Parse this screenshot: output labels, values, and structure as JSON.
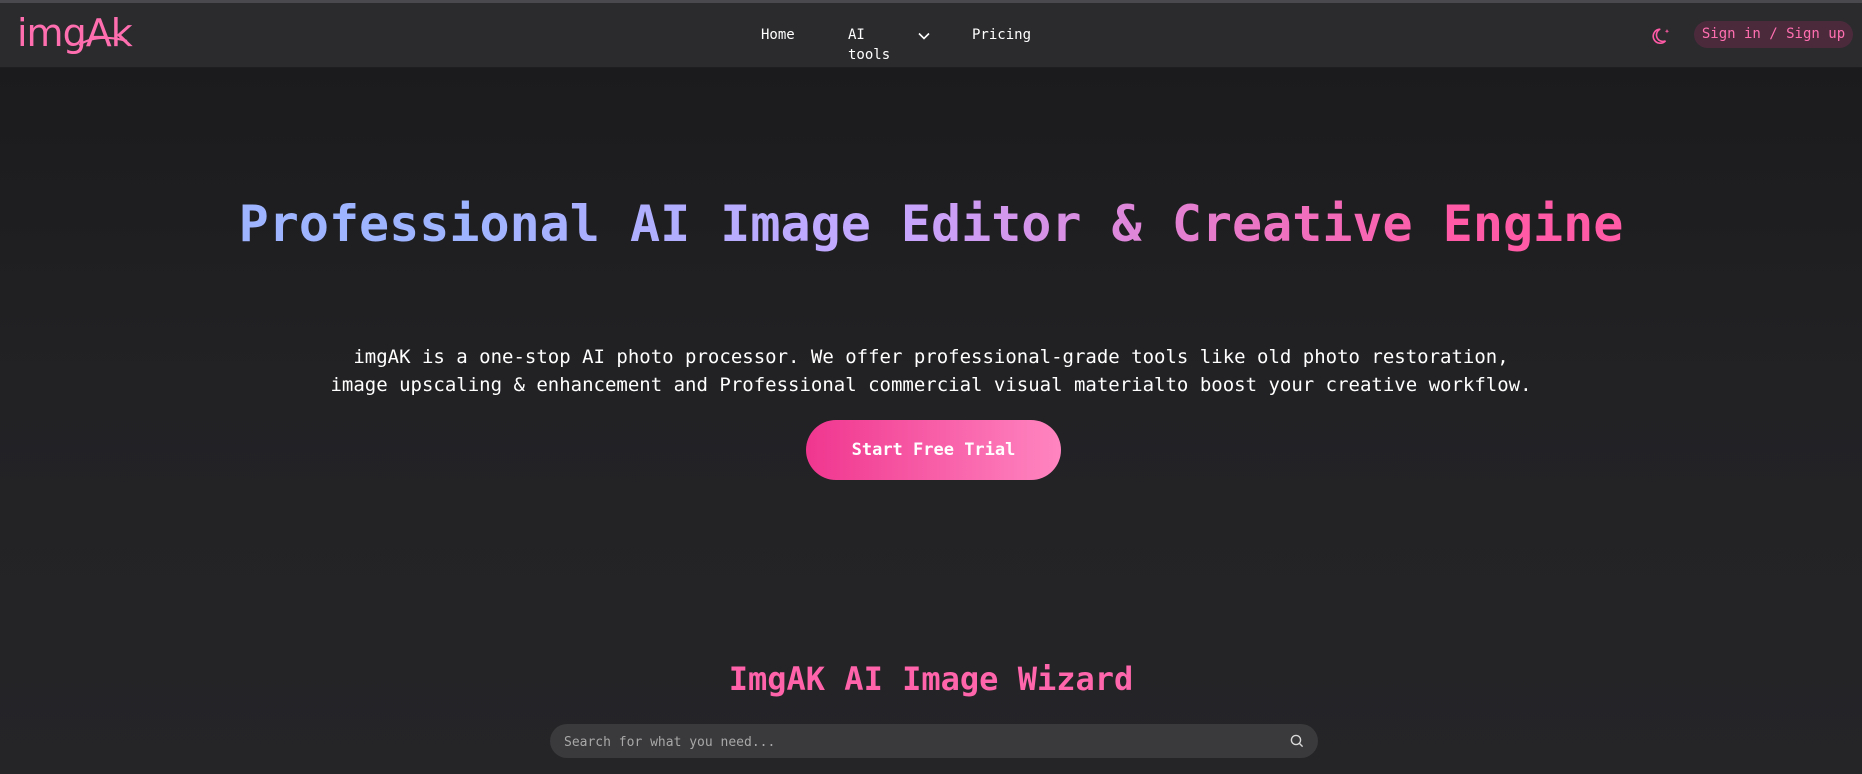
{
  "brand": {
    "logo_text": "imgAk",
    "accent": "#ff6fb0"
  },
  "nav": {
    "links": [
      {
        "label": "Home"
      },
      {
        "label": "AI tools",
        "icon": "chevron-down-icon"
      },
      {
        "label": "Pricing"
      }
    ],
    "theme_icon": "moon-icon",
    "signin_label": "Sign in / Sign up"
  },
  "hero": {
    "title": "Professional AI Image Editor & Creative Engine",
    "description": "imgAK is a one-stop AI photo processor. We offer professional-grade tools like old photo restoration, image upscaling & enhancement and Professional commercial visual materialto boost your creative workflow.",
    "cta_label": "Start Free Trial"
  },
  "wizard": {
    "title": "ImgAK AI Image Wizard",
    "search_placeholder": "Search for what you need...",
    "search_icon": "search-icon"
  }
}
